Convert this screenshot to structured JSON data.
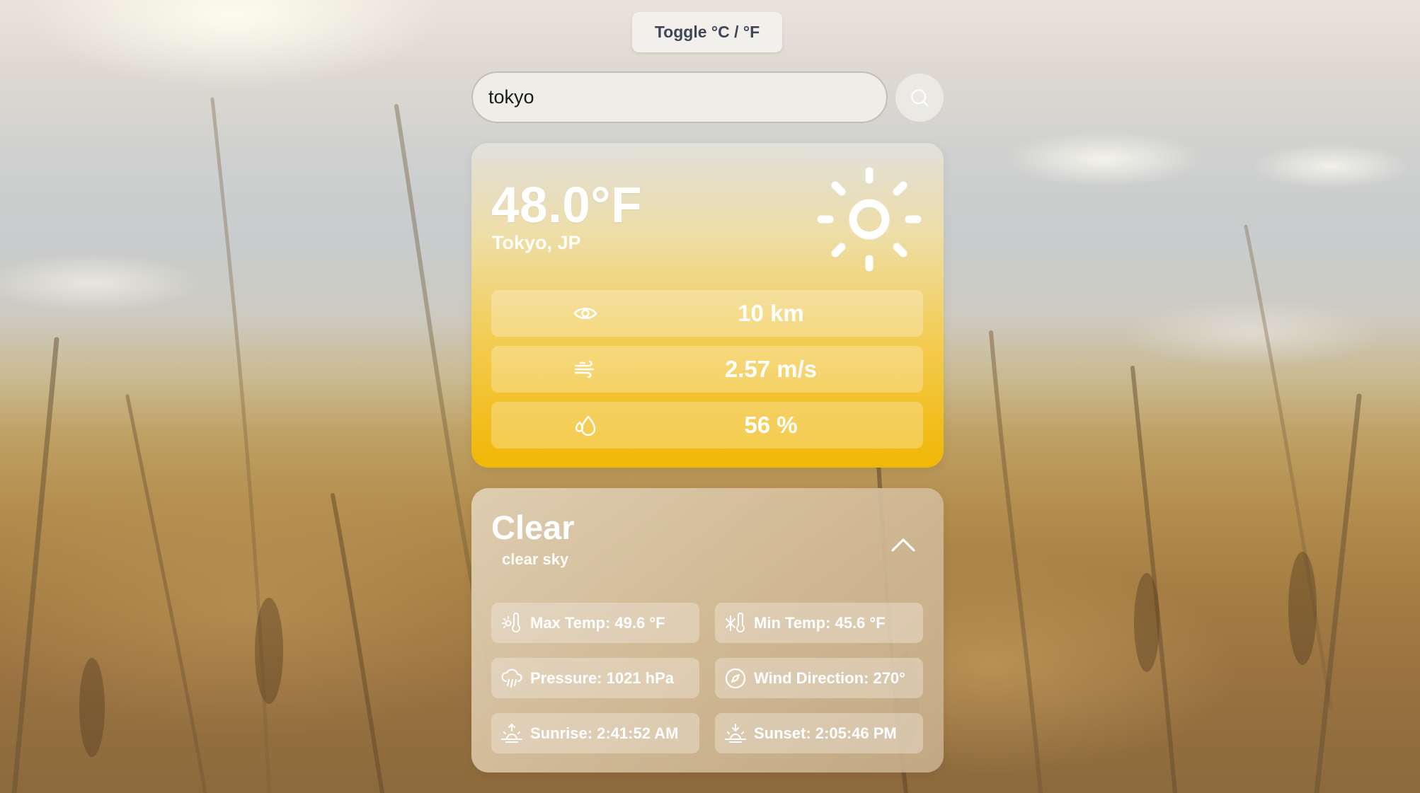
{
  "toggle": {
    "label": "Toggle °C / °F"
  },
  "search": {
    "value": "tokyo",
    "icon": "search-icon"
  },
  "current": {
    "temperature": "48.0°F",
    "location": "Tokyo, JP",
    "icon": "sun-icon",
    "stats": [
      {
        "icon": "eye-icon",
        "value": "10 km"
      },
      {
        "icon": "wind-icon",
        "value": "2.57 m/s"
      },
      {
        "icon": "humidity-icon",
        "value": "56 %"
      }
    ]
  },
  "details": {
    "condition": "Clear",
    "description": "clear sky",
    "collapse_icon": "chevron-up-icon",
    "items": [
      {
        "icon": "thermometer-sun-icon",
        "label": "Max Temp: 49.6 °F"
      },
      {
        "icon": "thermometer-snowflake-icon",
        "label": "Min Temp: 45.6 °F"
      },
      {
        "icon": "cloud-rain-icon",
        "label": "Pressure: 1021 hPa"
      },
      {
        "icon": "compass-icon",
        "label": "Wind Direction: 270°"
      },
      {
        "icon": "sunrise-icon",
        "label": "Sunrise: 2:41:52 AM"
      },
      {
        "icon": "sunset-icon",
        "label": "Sunset: 2:05:46 PM"
      }
    ]
  },
  "colors": {
    "card_top": "#f0ece4",
    "card_bottom": "#f1b705",
    "toggle_text": "#3f4756"
  }
}
